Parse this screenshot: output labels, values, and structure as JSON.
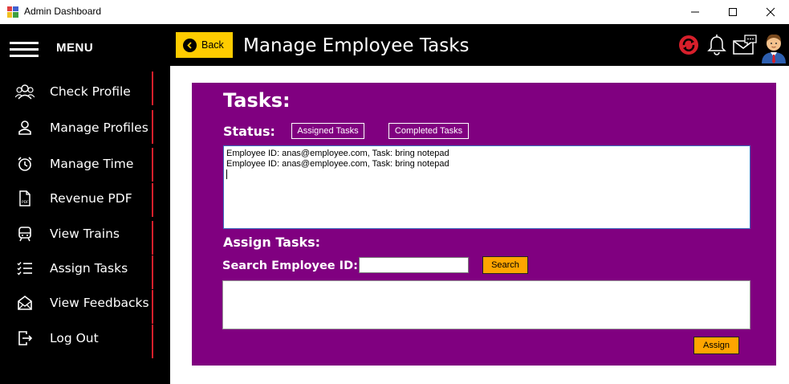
{
  "window": {
    "title": "Admin Dashboard"
  },
  "sidebar": {
    "menu_title": "MENU",
    "items": [
      {
        "label": "Check Profile",
        "icon": "people-group-icon"
      },
      {
        "label": "Manage Profiles",
        "icon": "user-icon"
      },
      {
        "label": "Manage Time",
        "icon": "alarm-clock-icon"
      },
      {
        "label": "Revenue PDF",
        "icon": "pdf-file-icon"
      },
      {
        "label": "View Trains",
        "icon": "train-icon"
      },
      {
        "label": "Assign Tasks",
        "icon": "task-list-icon"
      },
      {
        "label": "View Feedbacks",
        "icon": "feedback-mail-icon"
      },
      {
        "label": "Log Out",
        "icon": "logout-icon"
      }
    ]
  },
  "header": {
    "back_label": "Back",
    "page_title": "Manage Employee Tasks"
  },
  "main": {
    "tasks_heading": "Tasks:",
    "status_label": "Status:",
    "assigned_tasks_label": "Assigned Tasks",
    "completed_tasks_label": "Completed Tasks",
    "task_lines": [
      "Employee ID: anas@employee.com, Task: bring notepad",
      "Employee ID: anas@employee.com, Task: bring notepad"
    ],
    "assign_heading": "Assign Tasks:",
    "search_label": "Search Employee ID:",
    "search_value": "",
    "search_button": "Search",
    "assign_button": "Assign"
  },
  "colors": {
    "sidebar_bg": "#000000",
    "panel_bg": "#800080",
    "accent_yellow": "#ffcc00",
    "button_orange": "#ffa500",
    "divider_red": "#d71f2b"
  }
}
